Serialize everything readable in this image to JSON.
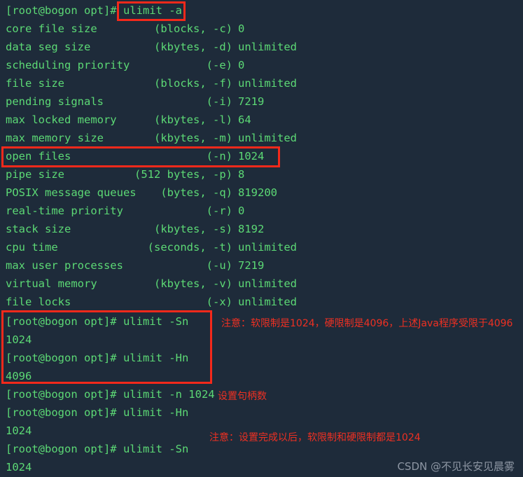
{
  "terminal": {
    "background_color": "#1e2b3a",
    "text_color": "#5cd975",
    "annotation_color": "#ef3022",
    "box_color": "#f4291b",
    "watermark_color": "#8d96a3"
  },
  "prompt": "[root@bogon opt]#",
  "lines": {
    "cmd_ulimit_a": "[root@bogon opt]# ",
    "cmd_ulimit_a_boxed": "ulimit -a",
    "cmd_sn": "[root@bogon opt]# ulimit -Sn",
    "out_sn_1024": "1024",
    "cmd_hn": "[root@bogon opt]# ulimit -Hn",
    "out_hn_4096": "4096",
    "cmd_set_n": "[root@bogon opt]# ulimit -n 1024",
    "cmd_hn_2": "[root@bogon opt]# ulimit -Hn",
    "out_hn_1024": "1024",
    "cmd_sn_2": "[root@bogon opt]# ulimit -Sn",
    "out_sn_1024_2": "1024"
  },
  "ulimit_table": [
    {
      "name": "core file size",
      "unit": "(blocks, -c)",
      "value": "0"
    },
    {
      "name": "data seg size",
      "unit": "(kbytes, -d)",
      "value": "unlimited"
    },
    {
      "name": "scheduling priority",
      "unit": "(-e)",
      "value": "0"
    },
    {
      "name": "file size",
      "unit": "(blocks, -f)",
      "value": "unlimited"
    },
    {
      "name": "pending signals",
      "unit": "(-i)",
      "value": "7219"
    },
    {
      "name": "max locked memory",
      "unit": "(kbytes, -l)",
      "value": "64"
    },
    {
      "name": "max memory size",
      "unit": "(kbytes, -m)",
      "value": "unlimited"
    },
    {
      "name": "open files",
      "unit": "(-n)",
      "value": "1024"
    },
    {
      "name": "pipe size",
      "unit": "(512 bytes, -p)",
      "value": "8"
    },
    {
      "name": "POSIX message queues",
      "unit": "(bytes, -q)",
      "value": "819200"
    },
    {
      "name": "real-time priority",
      "unit": "(-r)",
      "value": "0"
    },
    {
      "name": "stack size",
      "unit": "(kbytes, -s)",
      "value": "8192"
    },
    {
      "name": "cpu time",
      "unit": "(seconds, -t)",
      "value": "unlimited"
    },
    {
      "name": "max user processes",
      "unit": "(-u)",
      "value": "7219"
    },
    {
      "name": "virtual memory",
      "unit": "(kbytes, -v)",
      "value": "unlimited"
    },
    {
      "name": "file locks",
      "unit": "(-x)",
      "value": "unlimited"
    }
  ],
  "annotations": {
    "limits_note": "注意：软限制是1024，硬限制是4096，上述Java程序受限于4096",
    "set_handles": "设置句柄数",
    "after_set_note": "注意：设置完成以后，软限制和硬限制都是1024"
  },
  "watermark": "CSDN @不见长安见晨雾"
}
